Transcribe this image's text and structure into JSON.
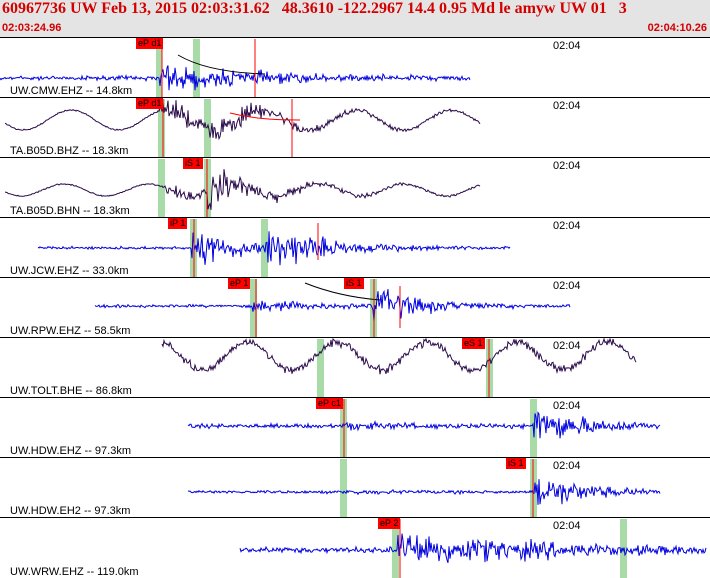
{
  "header": {
    "title": "60967736 UW Feb 13, 2015 02:03:31.62   48.3610 -122.2967 14.4 0.95 Md le amyw UW 01   3",
    "time_start": "02:03:24.96",
    "time_end": "02:04:10.26"
  },
  "minute_label": "02:04",
  "colors": {
    "header_bg": "#e4e4e4",
    "title": "#d40000",
    "blue": "#0000e0",
    "purple": "#2a0a4a",
    "pick": "#ff0000",
    "green": "#a8dba8"
  },
  "traces": [
    {
      "station": "UW.CMW.EHZ -- 14.8km",
      "color": "blue",
      "picks": [
        {
          "label": "eP d1"
        }
      ]
    },
    {
      "station": "TA.B05D.BHZ -- 18.3km",
      "color": "purple",
      "picks": [
        {
          "label": "eP d1"
        }
      ]
    },
    {
      "station": "TA.B05D.BHN -- 18.3km",
      "color": "purple",
      "picks": [
        {
          "label": "iS 1"
        }
      ]
    },
    {
      "station": "UW.JCW.EHZ -- 33.0km",
      "color": "blue",
      "picks": [
        {
          "label": "iP 1"
        }
      ]
    },
    {
      "station": "UW.RPW.EHZ -- 58.5km",
      "color": "blue",
      "picks": [
        {
          "label": "eP 1"
        },
        {
          "label": "iS 1"
        }
      ]
    },
    {
      "station": "UW.TOLT.BHE -- 86.8km",
      "color": "purple",
      "picks": [
        {
          "label": "eS 1"
        }
      ]
    },
    {
      "station": "UW.HDW.EHZ -- 97.3km",
      "color": "blue",
      "picks": [
        {
          "label": "eP c1"
        }
      ]
    },
    {
      "station": "UW.HDW.EH2 -- 97.3km",
      "color": "blue",
      "picks": [
        {
          "label": "iS 1"
        }
      ]
    },
    {
      "station": "UW.WRW.EHZ -- 119.0km",
      "color": "blue",
      "picks": [
        {
          "label": "eP 2"
        }
      ]
    }
  ]
}
